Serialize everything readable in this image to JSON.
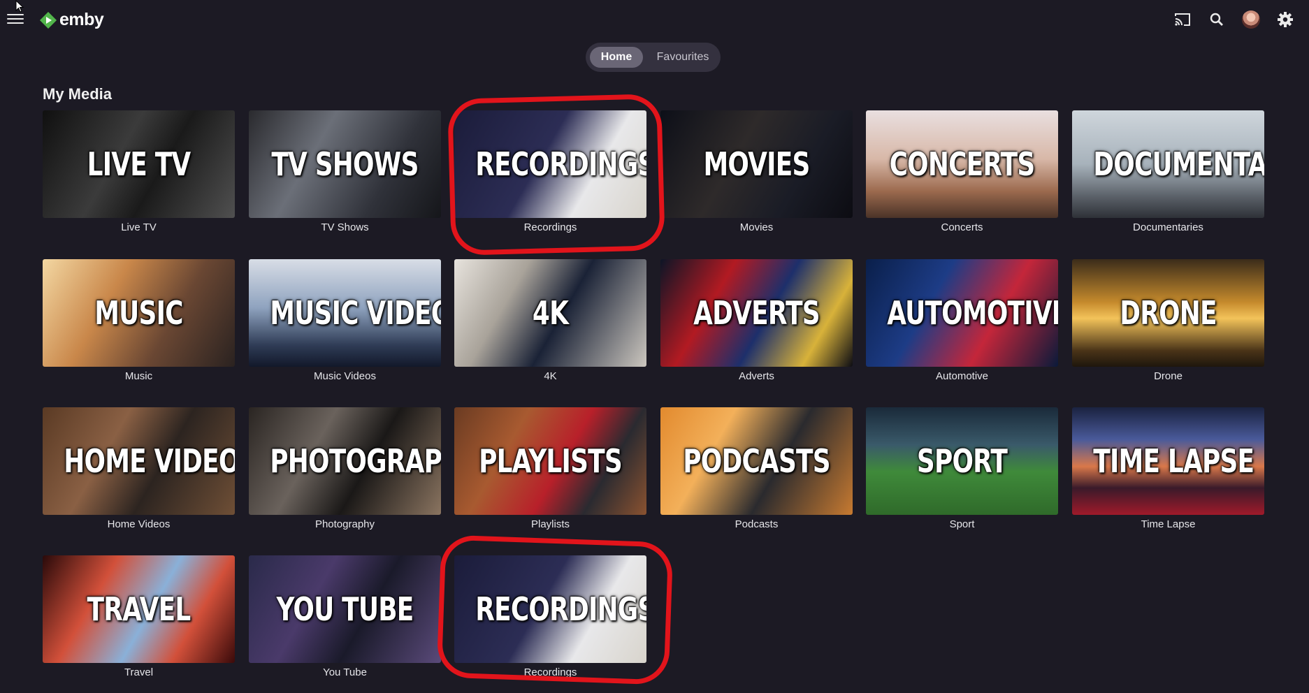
{
  "app": {
    "logo_text": "emby",
    "accent": "#52b54b"
  },
  "header": {
    "icons": [
      "menu-icon",
      "cast-icon",
      "search-icon",
      "user-avatar",
      "gear-icon"
    ]
  },
  "tabs": [
    {
      "label": "Home",
      "active": true
    },
    {
      "label": "Favourites",
      "active": false
    }
  ],
  "section": {
    "title": "My Media"
  },
  "libraries": [
    {
      "title": "LIVE TV",
      "label": "Live TV",
      "bg": "linear-gradient(120deg,#101010 0%,#3b3b3b 40%,#1a1a1a 60%,#505050 100%)"
    },
    {
      "title": "TV SHOWS",
      "label": "TV Shows",
      "bg": "linear-gradient(120deg,#2a2a2e 0%,#6b6f78 35%,#30323a 70%,#15161a 100%)"
    },
    {
      "title": "RECORDINGS",
      "label": "Recordings",
      "bg": "linear-gradient(120deg,#1b1c3a 0%,#2c2d55 45%,#e8e8ea 70%,#d8d4cc 100%)"
    },
    {
      "title": "MOVIES",
      "label": "Movies",
      "bg": "linear-gradient(120deg,#0d0f18 0%,#2e2a2a 40%,#1a1c26 70%,#0c0c12 100%)"
    },
    {
      "title": "CONCERTS",
      "label": "Concerts",
      "bg": "linear-gradient(180deg,#e9dfe0 0%,#d8b8a8 45%,#9c6a4e 75%,#4a3328 100%)"
    },
    {
      "title": "DOCUMENTARY",
      "label": "Documentaries",
      "bg": "linear-gradient(180deg,#cfd6dc 0%,#a7b2bb 50%,#5b6169 80%,#2e3137 100%)"
    },
    {
      "title": "MUSIC",
      "label": "Music",
      "bg": "linear-gradient(120deg,#f3d7a2 0%,#c9874a 35%,#6a4733 65%,#2a2220 100%)"
    },
    {
      "title": "MUSIC VIDEOS",
      "label": "Music Videos",
      "bg": "linear-gradient(180deg,#d8dde6 0%,#8fa3bf 45%,#2f3c56 80%,#12182a 100%)"
    },
    {
      "title": "4K",
      "label": "4K",
      "bg": "linear-gradient(120deg,#e7e3dd 0%,#a9a39a 30%,#1a2236 55%,#ccc7bf 100%)"
    },
    {
      "title": "ADVERTS",
      "label": "Adverts",
      "bg": "linear-gradient(120deg,#0d1526 0%,#b21a22 30%,#1d2f6b 55%,#d8b23a 80%,#0d0d14 100%)"
    },
    {
      "title": "AUTOMOTIVE",
      "label": "Automotive",
      "bg": "linear-gradient(120deg,#0a1f4a 0%,#1d3c86 35%,#c4263a 65%,#0a1a3a 100%)"
    },
    {
      "title": "DRONE",
      "label": "Drone",
      "bg": "linear-gradient(180deg,#3b2c1a 0%,#c58a2c 40%,#f3c35a 55%,#4a3418 85%,#1e160c 100%)"
    },
    {
      "title": "HOME VIDEOS",
      "label": "Home Videos",
      "bg": "linear-gradient(120deg,#5a3a24 0%,#8a6044 35%,#2c2420 60%,#6f4f36 100%)"
    },
    {
      "title": "PHOTOGRAPHY",
      "label": "Photography",
      "bg": "linear-gradient(120deg,#2a2522 0%,#6a625c 35%,#1a1817 60%,#8a7460 100%)"
    },
    {
      "title": "PLAYLISTS",
      "label": "Playlists",
      "bg": "linear-gradient(120deg,#6a3b22 0%,#a85a30 30%,#b8202a 55%,#2a2a30 75%,#8a5230 100%)"
    },
    {
      "title": "PODCASTS",
      "label": "Podcasts",
      "bg": "linear-gradient(120deg,#e28a2e 0%,#f3b05a 30%,#2a2a2e 60%,#c77a30 100%)"
    },
    {
      "title": "SPORT",
      "label": "Sport",
      "bg": "linear-gradient(180deg,#1a2a3a 0%,#3a5a6a 35%,#3f8a3a 60%,#2f6a2a 100%)"
    },
    {
      "title": "TIME LAPSE",
      "label": "Time Lapse",
      "bg": "linear-gradient(180deg,#1a2240 0%,#4a5a9a 30%,#d9784a 55%,#3a1a2a 75%,#a01a2a 100%)"
    },
    {
      "title": "TRAVEL",
      "label": "Travel",
      "bg": "linear-gradient(120deg,#2a0a0a 0%,#d2503a 30%,#8ab0d8 55%,#d2503a 75%,#3a0a0a 100%)"
    },
    {
      "title": "YOU TUBE",
      "label": "You Tube",
      "bg": "linear-gradient(120deg,#2a2a4a 0%,#4a3a6a 35%,#1a1a2a 60%,#5a4a7a 100%)"
    },
    {
      "title": "RECORDINGS",
      "label": "Recordings",
      "bg": "linear-gradient(120deg,#1b1c3a 0%,#2c2d55 45%,#e8e8ea 70%,#d8d4cc 100%)"
    }
  ],
  "annotations": {
    "highlight_color": "#e2141b"
  }
}
